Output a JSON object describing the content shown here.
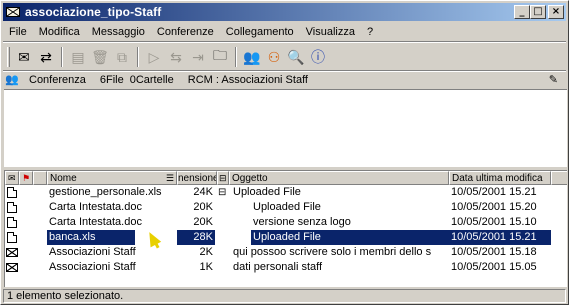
{
  "window": {
    "title": "associazione_tipo-Staff",
    "buttons": {
      "minimize": "_",
      "maximize": "□",
      "close": "×"
    }
  },
  "menubar": {
    "items": [
      "File",
      "Modifica",
      "Messaggio",
      "Conferenze",
      "Collegamento",
      "Visualizza",
      "?"
    ]
  },
  "toolbar": {
    "tools": [
      {
        "name": "new-message-icon",
        "glyph": "✉",
        "enabled": true
      },
      {
        "name": "reply-icon",
        "glyph": "⇄",
        "enabled": true
      },
      {
        "name": "print-icon",
        "glyph": "▤",
        "enabled": false
      },
      {
        "name": "delete-icon",
        "glyph": "🗑",
        "enabled": false
      },
      {
        "name": "copy-icon",
        "glyph": "⧉",
        "enabled": false
      },
      {
        "name": "forward-icon",
        "glyph": "▷",
        "enabled": false
      },
      {
        "name": "move-icon",
        "glyph": "⇆",
        "enabled": false
      },
      {
        "name": "attach-icon",
        "glyph": "⇥",
        "enabled": false
      },
      {
        "name": "folder-icon",
        "glyph": "🗀",
        "enabled": true
      },
      {
        "name": "users-icon",
        "glyph": "👥",
        "enabled": true
      },
      {
        "name": "group-icon",
        "glyph": "⚇",
        "enabled": true
      },
      {
        "name": "search-icon",
        "glyph": "🔍",
        "enabled": true
      },
      {
        "name": "info-icon",
        "glyph": "ⓘ",
        "enabled": true
      }
    ]
  },
  "infobar": {
    "type": "Conferenza",
    "files": "6File",
    "folders": "0Cartelle",
    "rcm": "RCM : Associazioni Staff"
  },
  "list": {
    "columns": {
      "name": "Nome",
      "size": "nensione",
      "subject": "Oggetto",
      "date": "Data ultima modifica"
    },
    "tree_marker": "⊟",
    "rows": [
      {
        "icon": "doc",
        "name": "gestione_personale.xls",
        "size": "24K",
        "tree": "⊟",
        "subject": "Uploaded File",
        "indent": 0,
        "date": "10/05/2001 15.21",
        "selected": false
      },
      {
        "icon": "doc",
        "name": "Carta Intestata.doc",
        "size": "20K",
        "tree": "",
        "subject": "Uploaded File",
        "indent": 1,
        "date": "10/05/2001 15.20",
        "selected": false
      },
      {
        "icon": "doc",
        "name": "Carta Intestata.doc",
        "size": "20K",
        "tree": "",
        "subject": "versione senza logo",
        "indent": 1,
        "date": "10/05/2001 15.10",
        "selected": false
      },
      {
        "icon": "doc",
        "name": "banca.xls",
        "size": "28K",
        "tree": "",
        "subject": "Uploaded File",
        "indent": 1,
        "date": "10/05/2001 15.21",
        "selected": true
      },
      {
        "icon": "mail",
        "name": "Associazioni Staff",
        "size": "2K",
        "tree": "",
        "subject": "qui possoo scrivere solo i membri dello s",
        "indent": 0,
        "date": "10/05/2001 15.18",
        "selected": false
      },
      {
        "icon": "mail",
        "name": "Associazioni Staff",
        "size": "1K",
        "tree": "",
        "subject": "dati personali staff",
        "indent": 0,
        "date": "10/05/2001 15.05",
        "selected": false
      }
    ]
  },
  "statusbar": {
    "text": "1 elemento selezionato."
  },
  "colors": {
    "selection": "#0a246a",
    "title_start": "#0a246a",
    "title_end": "#a6caf0"
  }
}
